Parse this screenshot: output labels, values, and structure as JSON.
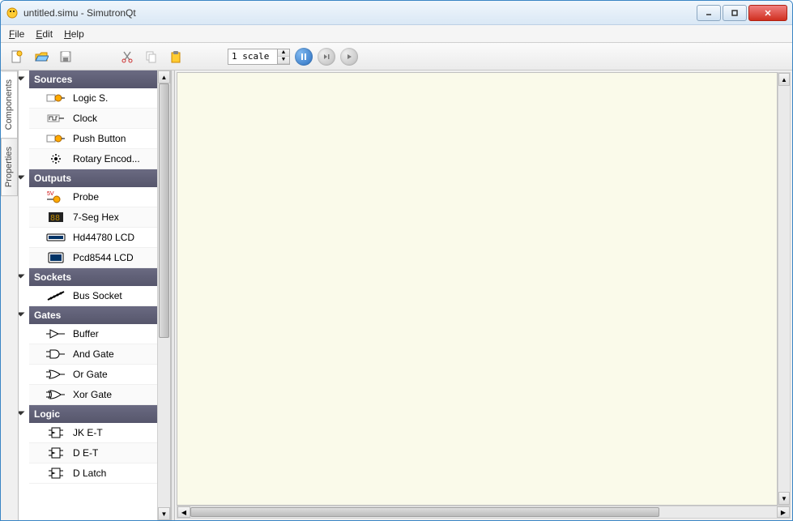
{
  "window": {
    "title": "untitled.simu - SimutronQt"
  },
  "menu": {
    "file": "File",
    "edit": "Edit",
    "help": "Help"
  },
  "toolbar": {
    "scale_value": "1 scale"
  },
  "side_tabs": {
    "components": "Components",
    "properties": "Properties"
  },
  "tree": {
    "categories": [
      {
        "name": "Sources",
        "items": [
          {
            "id": "logic-source-item",
            "label": "Logic S.",
            "icon": "logic-source-icon"
          },
          {
            "id": "clock-item",
            "label": "Clock",
            "icon": "clock-icon"
          },
          {
            "id": "push-button-item",
            "label": "Push Button",
            "icon": "push-button-icon"
          },
          {
            "id": "rotary-encoder-item",
            "label": "Rotary Encod...",
            "icon": "rotary-encoder-icon"
          }
        ]
      },
      {
        "name": "Outputs",
        "items": [
          {
            "id": "probe-item",
            "label": "Probe",
            "icon": "probe-icon"
          },
          {
            "id": "seven-seg-item",
            "label": "7-Seg Hex",
            "icon": "seven-seg-icon"
          },
          {
            "id": "hd44780-item",
            "label": "Hd44780 LCD",
            "icon": "lcd-wide-icon"
          },
          {
            "id": "pcd8544-item",
            "label": "Pcd8544 LCD",
            "icon": "lcd-icon"
          }
        ]
      },
      {
        "name": "Sockets",
        "items": [
          {
            "id": "bus-socket-item",
            "label": "Bus Socket",
            "icon": "bus-socket-icon"
          }
        ]
      },
      {
        "name": "Gates",
        "items": [
          {
            "id": "buffer-item",
            "label": "Buffer",
            "icon": "buffer-icon"
          },
          {
            "id": "and-gate-item",
            "label": "And Gate",
            "icon": "and-gate-icon"
          },
          {
            "id": "or-gate-item",
            "label": "Or Gate",
            "icon": "or-gate-icon"
          },
          {
            "id": "xor-gate-item",
            "label": "Xor Gate",
            "icon": "xor-gate-icon"
          }
        ]
      },
      {
        "name": "Logic",
        "items": [
          {
            "id": "jk-et-item",
            "label": "JK E-T",
            "icon": "flipflop-icon"
          },
          {
            "id": "d-et-item",
            "label": "D E-T",
            "icon": "flipflop-icon"
          },
          {
            "id": "d-latch-item",
            "label": "D Latch",
            "icon": "flipflop-icon"
          }
        ]
      }
    ]
  }
}
